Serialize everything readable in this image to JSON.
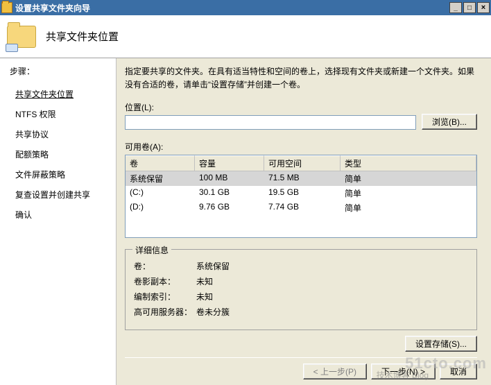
{
  "window": {
    "title": "设置共享文件夹向导",
    "min_glyph": "_",
    "max_glyph": "□",
    "close_glyph": "×"
  },
  "header": {
    "title": "共享文件夹位置"
  },
  "sidebar": {
    "heading": "步骤：",
    "steps": [
      "共享文件夹位置",
      "NTFS 权限",
      "共享协议",
      "配额策略",
      "文件屏蔽策略",
      "复查设置并创建共享",
      "确认"
    ],
    "current_index": 0
  },
  "instructions": "指定要共享的文件夹。在具有适当特性和空间的卷上，选择现有文件夹或新建一个文件夹。如果没有合适的卷，请单击“设置存储”并创建一个卷。",
  "location": {
    "label": "位置(L):",
    "value": "",
    "browse_btn": "浏览(B)..."
  },
  "volumes": {
    "label": "可用卷(A):",
    "columns": {
      "name": "卷",
      "capacity": "容量",
      "free": "可用空间",
      "type": "类型"
    },
    "rows": [
      {
        "name": "系统保留",
        "capacity": "100 MB",
        "free": "71.5 MB",
        "type": "简单",
        "selected": true
      },
      {
        "name": "(C:)",
        "capacity": "30.1 GB",
        "free": "19.5 GB",
        "type": "简单",
        "selected": false
      },
      {
        "name": "(D:)",
        "capacity": "9.76 GB",
        "free": "7.74 GB",
        "type": "简单",
        "selected": false
      }
    ]
  },
  "details": {
    "legend": "详细信息",
    "rows": [
      {
        "label": "卷：",
        "value": "系统保留"
      },
      {
        "label": "卷影副本：",
        "value": "未知"
      },
      {
        "label": "编制索引：",
        "value": "未知"
      },
      {
        "label": "高可用服务器：",
        "value": "卷未分簇"
      }
    ]
  },
  "buttons": {
    "set_storage": "设置存储(S)...",
    "prev": "< 上一步(P)",
    "next": "下一步(N) >",
    "cancel": "取消"
  },
  "watermark": {
    "brand": "51cto.com",
    "sub": "技术博客 Blog"
  }
}
